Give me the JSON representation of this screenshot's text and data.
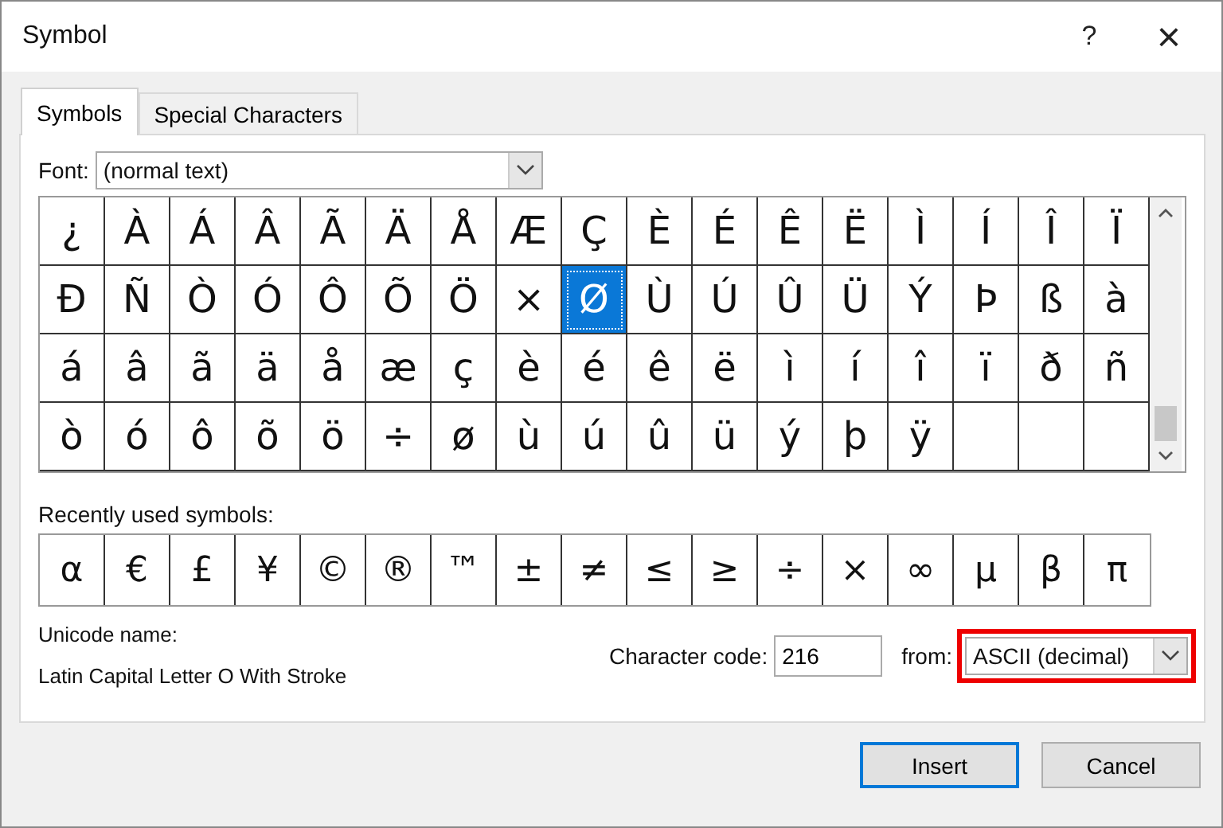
{
  "window": {
    "title": "Symbol",
    "help": "?",
    "close": "×"
  },
  "tabs": [
    {
      "label": "Symbols",
      "selected": true
    },
    {
      "label": "Special Characters",
      "selected": false
    }
  ],
  "font": {
    "label": "Font:",
    "value": "(normal text)"
  },
  "symbols": [
    {
      "char": "¿",
      "selected": false
    },
    {
      "char": "À",
      "selected": false
    },
    {
      "char": "Á",
      "selected": false
    },
    {
      "char": "Â",
      "selected": false
    },
    {
      "char": "Ã",
      "selected": false
    },
    {
      "char": "Ä",
      "selected": false
    },
    {
      "char": "Å",
      "selected": false
    },
    {
      "char": "Æ",
      "selected": false
    },
    {
      "char": "Ç",
      "selected": false
    },
    {
      "char": "È",
      "selected": false
    },
    {
      "char": "É",
      "selected": false
    },
    {
      "char": "Ê",
      "selected": false
    },
    {
      "char": "Ë",
      "selected": false
    },
    {
      "char": "Ì",
      "selected": false
    },
    {
      "char": "Í",
      "selected": false
    },
    {
      "char": "Î",
      "selected": false
    },
    {
      "char": "Ï",
      "selected": false
    },
    {
      "char": "Ð",
      "selected": false
    },
    {
      "char": "Ñ",
      "selected": false
    },
    {
      "char": "Ò",
      "selected": false
    },
    {
      "char": "Ó",
      "selected": false
    },
    {
      "char": "Ô",
      "selected": false
    },
    {
      "char": "Õ",
      "selected": false
    },
    {
      "char": "Ö",
      "selected": false
    },
    {
      "char": "×",
      "selected": false
    },
    {
      "char": "Ø",
      "selected": true
    },
    {
      "char": "Ù",
      "selected": false
    },
    {
      "char": "Ú",
      "selected": false
    },
    {
      "char": "Û",
      "selected": false
    },
    {
      "char": "Ü",
      "selected": false
    },
    {
      "char": "Ý",
      "selected": false
    },
    {
      "char": "Þ",
      "selected": false
    },
    {
      "char": "ß",
      "selected": false
    },
    {
      "char": "à",
      "selected": false
    },
    {
      "char": "á",
      "selected": false
    },
    {
      "char": "â",
      "selected": false
    },
    {
      "char": "ã",
      "selected": false
    },
    {
      "char": "ä",
      "selected": false
    },
    {
      "char": "å",
      "selected": false
    },
    {
      "char": "æ",
      "selected": false
    },
    {
      "char": "ç",
      "selected": false
    },
    {
      "char": "è",
      "selected": false
    },
    {
      "char": "é",
      "selected": false
    },
    {
      "char": "ê",
      "selected": false
    },
    {
      "char": "ë",
      "selected": false
    },
    {
      "char": "ì",
      "selected": false
    },
    {
      "char": "í",
      "selected": false
    },
    {
      "char": "î",
      "selected": false
    },
    {
      "char": "ï",
      "selected": false
    },
    {
      "char": "ð",
      "selected": false
    },
    {
      "char": "ñ",
      "selected": false
    },
    {
      "char": "ò",
      "selected": false
    },
    {
      "char": "ó",
      "selected": false
    },
    {
      "char": "ô",
      "selected": false
    },
    {
      "char": "õ",
      "selected": false
    },
    {
      "char": "ö",
      "selected": false
    },
    {
      "char": "÷",
      "selected": false
    },
    {
      "char": "ø",
      "selected": false
    },
    {
      "char": "ù",
      "selected": false
    },
    {
      "char": "ú",
      "selected": false
    },
    {
      "char": "û",
      "selected": false
    },
    {
      "char": "ü",
      "selected": false
    },
    {
      "char": "ý",
      "selected": false
    },
    {
      "char": "þ",
      "selected": false
    },
    {
      "char": "ÿ",
      "selected": false
    }
  ],
  "recent": {
    "label": "Recently used symbols:",
    "symbols": [
      "α",
      "€",
      "£",
      "¥",
      "©",
      "®",
      "™",
      "±",
      "≠",
      "≤",
      "≥",
      "÷",
      "×",
      "∞",
      "µ",
      "β",
      "π"
    ]
  },
  "unicode_name": {
    "label": "Unicode name:",
    "value": "Latin Capital Letter O With Stroke"
  },
  "character_code": {
    "label": "Character code:",
    "value": "216"
  },
  "from": {
    "label": "from:",
    "value": "ASCII (decimal)",
    "highlighted": true
  },
  "buttons": [
    {
      "label": "Insert",
      "default": true
    },
    {
      "label": "Cancel",
      "default": false
    }
  ]
}
